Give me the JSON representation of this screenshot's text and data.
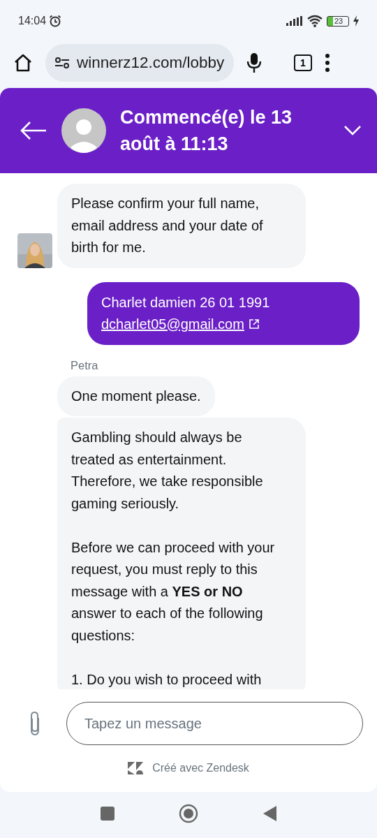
{
  "status_bar": {
    "time": "14:04",
    "battery": "23"
  },
  "browser": {
    "url": "winnerz12.com/lobby",
    "tab_count": "1"
  },
  "header": {
    "title": "Commencé(e) le 13 août à 11:13"
  },
  "messages": [
    {
      "kind": "agent",
      "avatar": true,
      "paragraphs": [
        "Please confirm your full name, email address and your date of birth for me."
      ]
    },
    {
      "kind": "user",
      "text": "Charlet damien 26 01 1991",
      "link": "dcharlet05@gmail.com"
    },
    {
      "kind": "sender",
      "text": "Petra"
    },
    {
      "kind": "agent",
      "avatar": false,
      "paragraphs": [
        "One moment please."
      ]
    },
    {
      "kind": "agent",
      "avatar": false,
      "paragraphs": [
        "Gambling should always be treated as entertainment. Therefore, we take responsible gaming seriously.",
        "Before we can proceed with your request, you must reply to this message with a **YES or NO** answer to each of the following questions:",
        "1. Do you wish to proceed with"
      ]
    }
  ],
  "composer": {
    "placeholder": "Tapez un message"
  },
  "footer": {
    "text": "Créé avec Zendesk"
  }
}
